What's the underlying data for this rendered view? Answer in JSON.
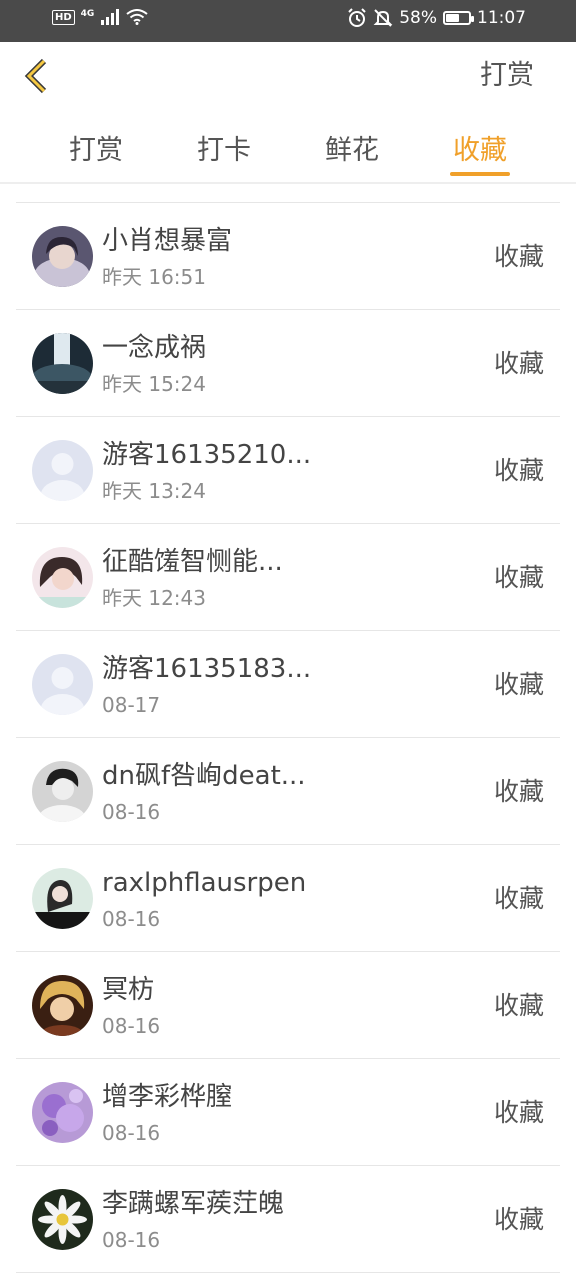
{
  "status_bar": {
    "network": "4G",
    "hd": "HD",
    "battery": "58%",
    "battery_level": 0.58,
    "time": "11:07",
    "icons": [
      "signal-icon",
      "wifi-icon",
      "alarm-icon",
      "mute-icon",
      "battery-icon"
    ]
  },
  "header": {
    "back_icon": "chevron-left-icon",
    "action_label": "打赏"
  },
  "tabs": [
    {
      "label": "打赏",
      "active": false
    },
    {
      "label": "打卡",
      "active": false
    },
    {
      "label": "鲜花",
      "active": false
    },
    {
      "label": "收藏",
      "active": true
    }
  ],
  "accent_color": "#f0a02a",
  "items": [
    {
      "name": "小肖想暴富",
      "time": "昨天 16:51",
      "action": "收藏",
      "avatar": "photo"
    },
    {
      "name": "一念成祸",
      "time": "昨天 15:24",
      "action": "收藏",
      "avatar": "photo"
    },
    {
      "name": "游客16135210...",
      "time": "昨天 13:24",
      "action": "收藏",
      "avatar": "default-user"
    },
    {
      "name": "征酷馐智恻能...",
      "time": "昨天 12:43",
      "action": "收藏",
      "avatar": "photo"
    },
    {
      "name": "游客16135183...",
      "time": "08-17",
      "action": "收藏",
      "avatar": "default-user"
    },
    {
      "name": "dn砜f咎峋deat...",
      "time": "08-16",
      "action": "收藏",
      "avatar": "photo"
    },
    {
      "name": "raxlphflausrpen",
      "time": "08-16",
      "action": "收藏",
      "avatar": "photo"
    },
    {
      "name": "冥枋",
      "time": "08-16",
      "action": "收藏",
      "avatar": "photo"
    },
    {
      "name": "增李彩桦膣",
      "time": "08-16",
      "action": "收藏",
      "avatar": "photo"
    },
    {
      "name": "李蹒螺军蒺茳魄",
      "time": "08-16",
      "action": "收藏",
      "avatar": "photo"
    }
  ]
}
